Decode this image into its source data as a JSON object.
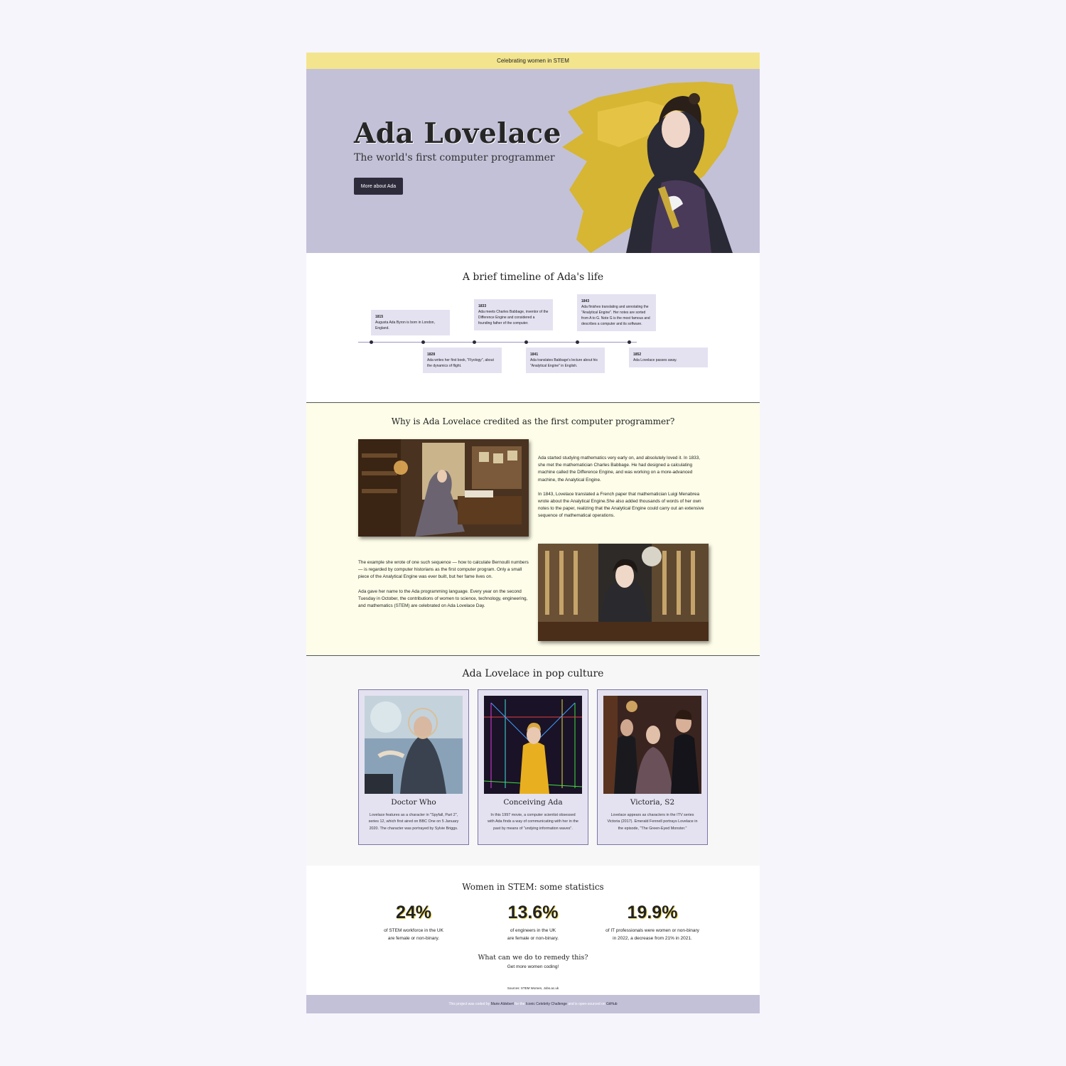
{
  "banner": "Celebrating women in STEM",
  "hero": {
    "title": "Ada Lovelace",
    "subtitle": "The world's first computer programmer",
    "button": "More about Ada"
  },
  "timeline": {
    "heading": "A brief timeline of Ada's life",
    "events": [
      {
        "year": "1815",
        "text": "Augusta Ada Byron is born in London, England."
      },
      {
        "year": "1828",
        "text": "Ada writes her first book, \"Flyology\", about the dynamics of flight."
      },
      {
        "year": "1833",
        "text": "Ada meets Charles Babbage, inventor of the Difference Engine and considered a founding father of the computer."
      },
      {
        "year": "1841",
        "text": "Ada translates Babbage's lecture about his \"Analytical Engine\" in English."
      },
      {
        "year": "1843",
        "text": "Ada finishes translating and annotating the \"Analytical Engine\". Her notes are sorted from A to G. Note G is the most famous and describes a computer and its software."
      },
      {
        "year": "1852",
        "text": "Ada Lovelace passes away."
      }
    ]
  },
  "why": {
    "heading": "Why is Ada Lovelace credited as the first computer programmer?",
    "p1": "Ada started studying mathematics very early on, and absolutely loved it. In 1833, she met the mathematician Charles Babbage. He had designed a calculating machine called the Difference Engine, and was working on a more-advanced machine, the Analytical Engine.",
    "p2": "In 1843, Lovelace translated a French paper that mathematician Luigi Menabrea wrote about the Analytical Engine.She also added thousands of words of her own notes to the paper, realizing that the Analytical Engine could carry out an extensive sequence of mathematical operations.",
    "p3": "The example she wrote of one such sequence — how to calculate Bernoulli numbers — is regarded by computer historians as the first computer program. Only a small piece of the Analytical Engine was ever built, but her fame lives on.",
    "p4": "Ada gave her name to the Ada programming language. Every year on the second Tuesday in October, the contributions of women to science, technology, engineering, and mathematics (STEM) are celebrated on Ada Lovelace Day."
  },
  "pop": {
    "heading": "Ada Lovelace in pop culture",
    "cards": [
      {
        "title": "Doctor Who",
        "text": "Lovelace features as a character in \"Spyfall, Part 2\", series 12, which first aired on BBC One on 5 January 2020. The character was portrayed by Sylvie Briggs."
      },
      {
        "title": "Conceiving Ada",
        "text": "In this 1997 movie, a computer scientist obsessed with Ada finds a way of communicating with her in the past by means of \"undying information waves\"."
      },
      {
        "title": "Victoria, S2",
        "text": "Lovelace appears as characters in the ITV series Victoria (2017). Emerald Fennell portrays Lovelace in the episode, \"The Green-Eyed Monster.\""
      }
    ]
  },
  "stats": {
    "heading": "Women in STEM: some statistics",
    "items": [
      {
        "value": "24%",
        "line1": "of STEM workforce in the UK",
        "line2": "are female or non-binary."
      },
      {
        "value": "13.6%",
        "line1": "of engineers in the UK",
        "line2": "are female or non-binary."
      },
      {
        "value": "19.9%",
        "line1": "of IT professionals were women or non-binary",
        "line2": "in 2022, a decrease from 21% in 2021."
      }
    ],
    "question": "What can we do to remedy this?",
    "answer": "Get more women coding!",
    "sources": "Sources: STEM Women, Jobs.ac.uk"
  },
  "footer": {
    "t1": "This project was coded by ",
    "author": "Marie Aldebert",
    "t2": " for the ",
    "challenge": "Iconic Celebrity Challenge",
    "t3": " and is open-sourced on ",
    "github": "GitHub"
  },
  "colors": {
    "banner": "#f3e58e",
    "hero_bg": "#c3c1d8",
    "timeline_box": "#e4e2f1",
    "why_bg": "#fdfde9",
    "button": "#2e2c3b"
  }
}
